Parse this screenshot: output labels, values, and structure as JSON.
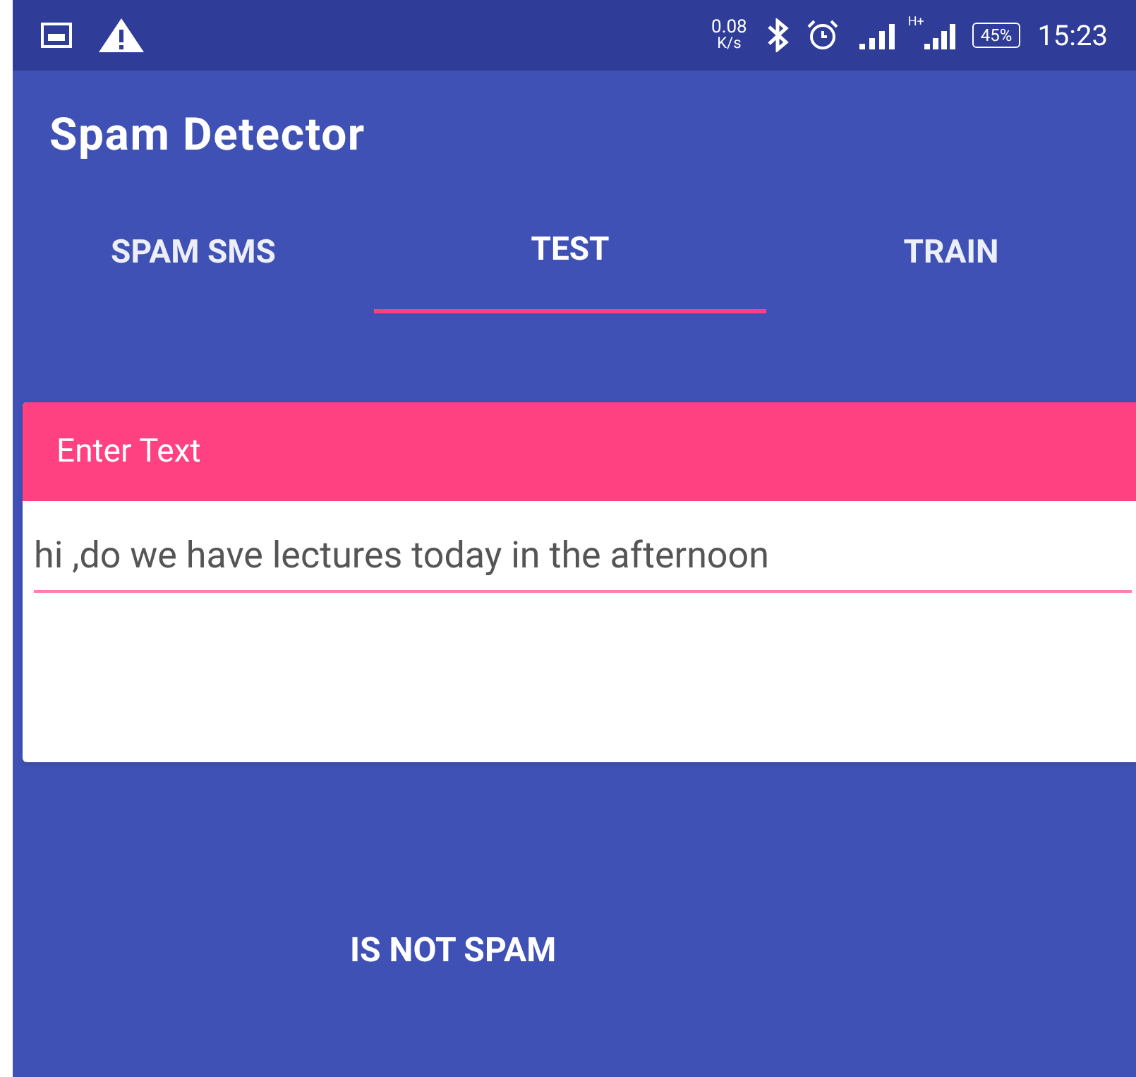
{
  "status_bar": {
    "speed": "0.08",
    "speed_unit": "K/s",
    "network": "H+",
    "battery": "45%",
    "time": "15:23"
  },
  "app_bar": {
    "title": "Spam Detector"
  },
  "tabs": [
    {
      "label": "SPAM SMS",
      "selected": false
    },
    {
      "label": "TEST",
      "selected": true
    },
    {
      "label": "TRAIN",
      "selected": false
    }
  ],
  "card": {
    "header": "Enter Text",
    "value": "hi ,do we have lectures today in the afternoon"
  },
  "result": "IS NOT SPAM"
}
